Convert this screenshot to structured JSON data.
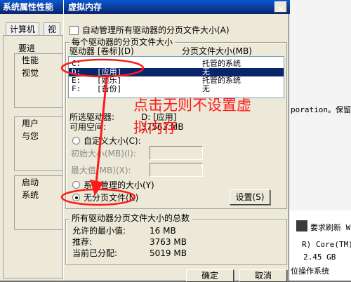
{
  "sysprops": {
    "title": "系统属性",
    "tabs": [
      "计算机",
      "视"
    ],
    "intro": "要进",
    "groups": [
      {
        "lines": [
          "性能",
          "视觉"
        ]
      },
      {
        "lines": [
          "用户",
          "与您"
        ]
      },
      {
        "lines": [
          "启动",
          "系统"
        ]
      }
    ]
  },
  "perf_title": "性能",
  "dialog": {
    "title": "虚拟内存",
    "auto_manage": "自动管理所有驱动器的分页文件大小(A)",
    "group1_title": "每个驱动器的分页文件大小",
    "col_drive": "驱动器 [卷标](D)",
    "col_size": "分页文件大小(MB)",
    "drives": [
      {
        "drive": "C:",
        "label": "",
        "size": "托管的系统",
        "selected": false
      },
      {
        "drive": "D:",
        "label": "[应用]",
        "size": "无",
        "selected": true
      },
      {
        "drive": "E:",
        "label": "[娱乐]",
        "size": "托管的系统",
        "selected": false
      },
      {
        "drive": "F:",
        "label": "[备份]",
        "size": "无",
        "selected": false
      }
    ],
    "selected_drive_label": "所选驱动器:",
    "selected_drive_value": "D:  [应用]",
    "free_space_label": "可用空间:",
    "free_space_value": "37563 MB",
    "custom_size": "自定义大小(C):",
    "initial_size": "初始大小(MB)(I):",
    "max_size": "最大值(MB)(X):",
    "system_managed": "系统管理的大小(Y)",
    "no_paging": "无分页文件(N)",
    "set_button": "设置(S)",
    "group2_title": "所有驱动器分页文件大小的总数",
    "min_allowed_label": "允许的最小值:",
    "min_allowed_value": "16 MB",
    "recommended_label": "推荐:",
    "recommended_value": "3763 MB",
    "allocated_label": "当前已分配:",
    "allocated_value": "5019 MB",
    "ok_button": "确定",
    "cancel_button": "取消"
  },
  "right_bg": {
    "corp_text": "poration。保留",
    "refresh_text": "要求刷新 Wi",
    "cpu_text": "R) Core(TM)",
    "freq_text": "2.45 GB",
    "os_text": "位操作系统"
  },
  "annotation": {
    "line1": "点击无则不设置虚",
    "line2": "拟内存"
  },
  "colors": {
    "accent": "#0a246a",
    "annotation": "#ff1a1a"
  }
}
